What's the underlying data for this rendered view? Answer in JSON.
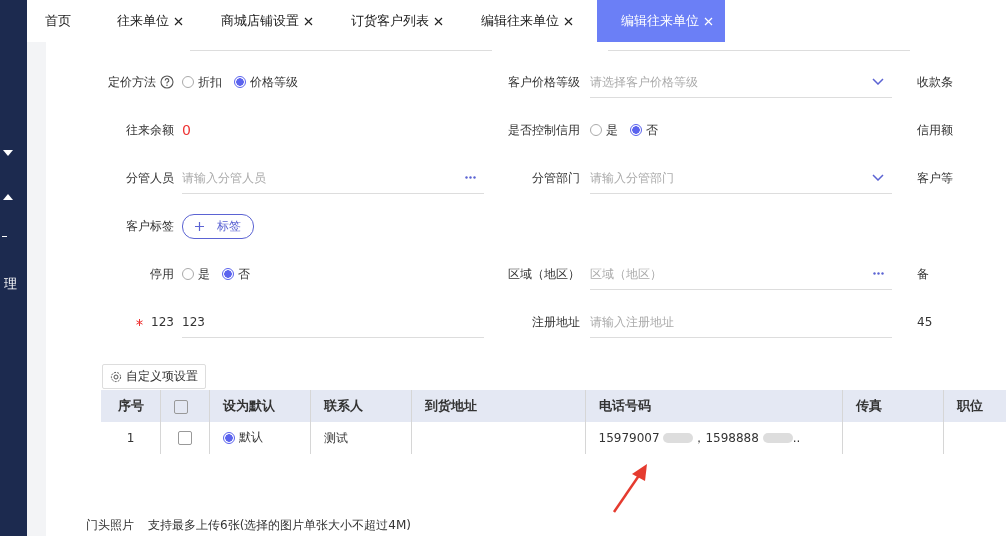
{
  "sidebar": {
    "items": [
      {
        "kind": "down"
      },
      {
        "kind": "up"
      },
      {
        "kind": "dash"
      },
      {
        "kind": "text",
        "label": "理"
      }
    ]
  },
  "tabs": [
    {
      "label": "首页",
      "closable": false,
      "selected": false
    },
    {
      "label": "往来单位",
      "closable": true,
      "selected": false
    },
    {
      "label": "商城店铺设置",
      "closable": true,
      "selected": false
    },
    {
      "label": "订货客户列表",
      "closable": true,
      "selected": false
    },
    {
      "label": "编辑往来单位",
      "closable": true,
      "selected": false
    },
    {
      "label": "编辑往来单位",
      "closable": true,
      "selected": true
    }
  ],
  "form": {
    "rows": [
      [
        {
          "label": "定价方法",
          "help": true,
          "kind": "radio",
          "options": [
            {
              "label": "折扣",
              "selected": false
            },
            {
              "label": "价格等级",
              "selected": true
            }
          ]
        },
        {
          "label": "客户价格等级",
          "kind": "select",
          "placeholder": "请选择客户价格等级"
        },
        {
          "label": "收款条"
        }
      ],
      [
        {
          "label": "往来余额",
          "kind": "value",
          "value": "0"
        },
        {
          "label": "是否控制信用",
          "kind": "radio",
          "options": [
            {
              "label": "是",
              "selected": false
            },
            {
              "label": "否",
              "selected": true
            }
          ]
        },
        {
          "label": "信用额"
        }
      ],
      [
        {
          "label": "分管人员",
          "kind": "picker",
          "placeholder": "请输入分管人员"
        },
        {
          "label": "分管部门",
          "kind": "select",
          "placeholder": "请输入分管部门"
        },
        {
          "label": "客户等"
        }
      ],
      [
        {
          "label": "客户标签",
          "kind": "tag",
          "button": "标签"
        }
      ],
      [
        {
          "label": "停用",
          "kind": "radio",
          "options": [
            {
              "label": "是",
              "selected": false
            },
            {
              "label": "否",
              "selected": true
            }
          ]
        },
        {
          "label": "区域（地区）",
          "kind": "picker",
          "placeholder": "区域（地区）"
        },
        {
          "label": "备"
        }
      ],
      [
        {
          "label": "123",
          "required": true,
          "kind": "text",
          "value": "123"
        },
        {
          "label": "注册地址",
          "kind": "text",
          "placeholder": "请输入注册地址"
        },
        {
          "label": "45"
        }
      ]
    ]
  },
  "custom_button": "自定义项设置",
  "contacts": {
    "all_checked": false,
    "columns": [
      "序号",
      "",
      "设为默认",
      "联系人",
      "到货地址",
      "电话号码",
      "传真",
      "职位"
    ],
    "rows": [
      {
        "index": "1",
        "checked": false,
        "default_label": "默认",
        "default": true,
        "contact": "测试",
        "address": "",
        "phone_parts": [
          "15979007",
          "，1598888",
          ".."
        ],
        "fax": "",
        "position": ""
      }
    ]
  },
  "photos": {
    "label": "门头照片",
    "hint": "支持最多上传6张(选择的图片单张大小不超过4M)"
  }
}
